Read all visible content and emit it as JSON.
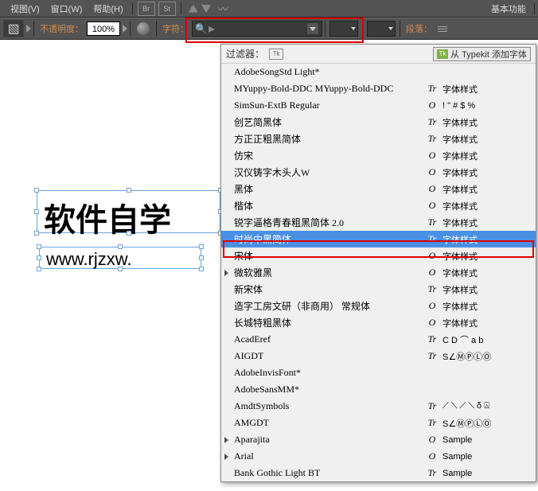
{
  "menubar": {
    "items": [
      "视图(V)",
      "窗口(W)",
      "帮助(H)"
    ],
    "icon_boxes": [
      "Br",
      "St"
    ],
    "right_label": "基本功能"
  },
  "toolbar": {
    "opacity_label": "不透明度：",
    "opacity_value": "100%",
    "char_label": "字符：",
    "para_label": "段落："
  },
  "canvas": {
    "text1": "软件自学",
    "text2": "www.rjzxw."
  },
  "font_menu": {
    "filter_label": "过滤器：",
    "tk_box": "Tk",
    "tk_badge": "Tk",
    "tk_text": "从 Typekit 添加字体",
    "fonts": [
      {
        "name": "AdobeSongStd Light*",
        "type": "",
        "sample": ""
      },
      {
        "name": "MYuppy-Bold-DDC MYuppy-Bold-DDC",
        "type": "Tr",
        "sample": "字体样式"
      },
      {
        "name": "SimSun-ExtB Regular",
        "type": "O",
        "sample": "! \" # $ %"
      },
      {
        "name": "创艺简黑体",
        "type": "Tr",
        "sample": "字体样式"
      },
      {
        "name": "方正正粗黑简体",
        "type": "Tr",
        "sample": "字体样式"
      },
      {
        "name": "仿宋",
        "type": "O",
        "sample": "字体样式"
      },
      {
        "name": "汉仪铸字木头人W",
        "type": "O",
        "sample": "字体样式"
      },
      {
        "name": "黑体",
        "type": "O",
        "sample": "字体样式"
      },
      {
        "name": "楷体",
        "type": "O",
        "sample": "字体样式"
      },
      {
        "name": "锐字逼格青春粗黑简体 2.0",
        "type": "Tr",
        "sample": "字体样式"
      },
      {
        "name": "时尚中黑简体",
        "type": "Tr",
        "sample": "字体样式",
        "active": true
      },
      {
        "name": "宋体",
        "type": "O",
        "sample": "字体样式"
      },
      {
        "name": "微软雅黑",
        "type": "O",
        "sample": "字体样式",
        "arrow": true
      },
      {
        "name": "新宋体",
        "type": "Tr",
        "sample": "字体样式"
      },
      {
        "name": "造字工房文研（非商用） 常规体",
        "type": "O",
        "sample": "字体样式"
      },
      {
        "name": "长城特粗黑体",
        "type": "O",
        "sample": "字体样式"
      },
      {
        "name": "AcadEref",
        "type": "Tr",
        "sample": "C D ⌒ a b"
      },
      {
        "name": "AIGDT",
        "type": "Tr",
        "sample": "S∠ⓂⓅⓁⓄ"
      },
      {
        "name": "AdobeInvisFont*",
        "type": "",
        "sample": ""
      },
      {
        "name": "AdobeSansMM*",
        "type": "",
        "sample": ""
      },
      {
        "name": "AmdtSymbols",
        "type": "Tr",
        "sample": "⟋ ⟍ ⟋ ⟍ δ ⍓"
      },
      {
        "name": "AMGDT",
        "type": "Tr",
        "sample": "S∠ⓂⓅⓁⓄ"
      },
      {
        "name": "Aparajita",
        "type": "O",
        "sample": "Sample",
        "arrow": true
      },
      {
        "name": "Arial",
        "type": "O",
        "sample": "Sample",
        "arrow": true
      },
      {
        "name": "Bank Gothic Light BT",
        "type": "Tr",
        "sample": "Sample"
      }
    ]
  }
}
